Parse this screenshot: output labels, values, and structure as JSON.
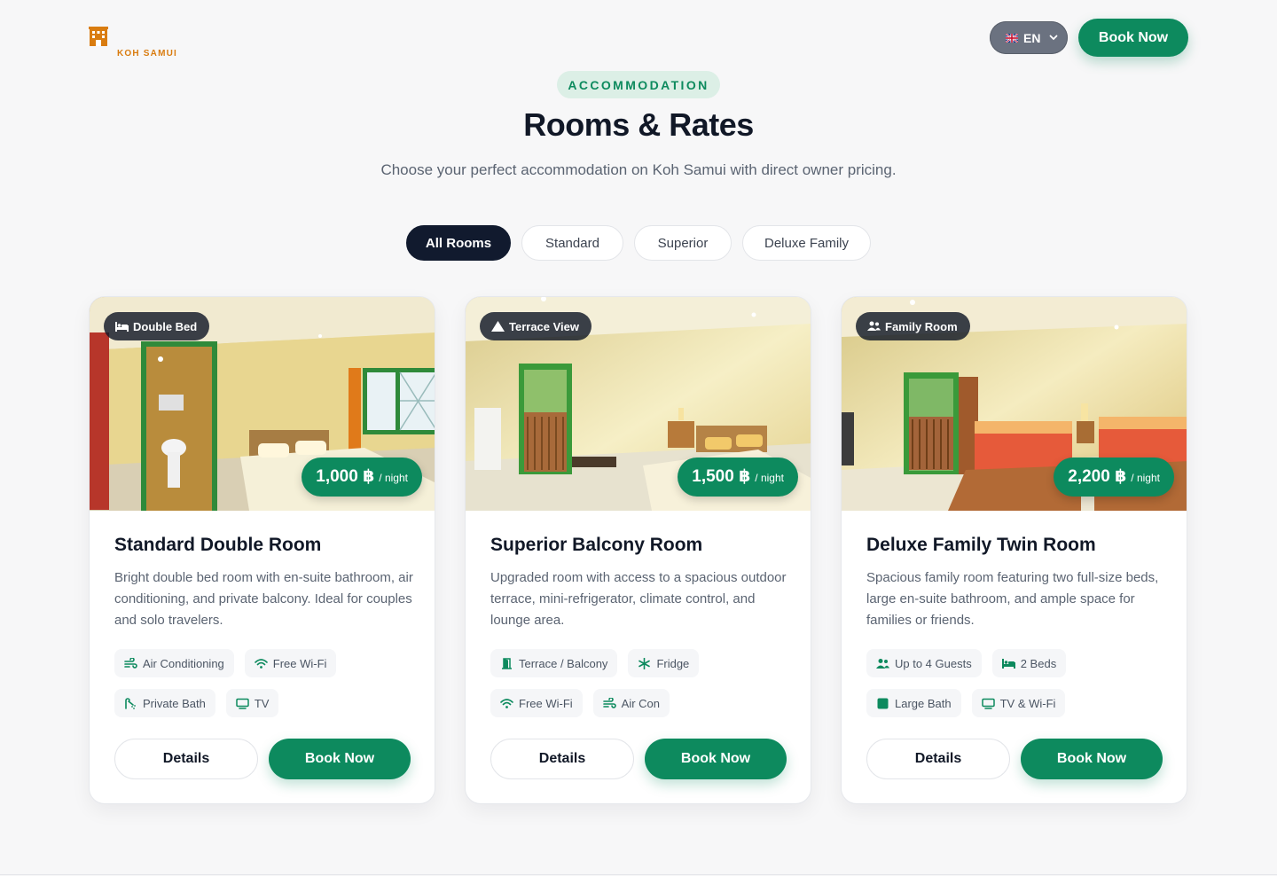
{
  "header": {
    "logo_name": "",
    "logo_sub": "KOH SAMUI",
    "language": "EN",
    "book_now": "Book Now"
  },
  "hero": {
    "eyebrow": "ACCOMMODATION",
    "title": "Rooms & Rates",
    "subtitle": "Choose your perfect accommodation on Koh Samui with direct owner pricing."
  },
  "filters": {
    "tabs": [
      "All Rooms",
      "Standard",
      "Superior",
      "Deluxe Family"
    ],
    "active": "All Rooms"
  },
  "colors": {
    "brand_green": "#0d8a5e",
    "dark_navy": "#111a2e",
    "accent_orange": "#d97c10"
  },
  "rooms": [
    {
      "badge": "Double Bed",
      "badge_icon": "bed-icon",
      "price": "1,000 ฿",
      "price_unit": "/ night",
      "title": "Standard Double Room",
      "description": "Bright double bed room with en-suite bathroom, air conditioning, and private balcony. Ideal for couples and solo travelers.",
      "amenities": [
        {
          "label": "Air Conditioning",
          "icon": "wind-icon"
        },
        {
          "label": "Free Wi-Fi",
          "icon": "wifi-icon"
        },
        {
          "label": "Private Bath",
          "icon": "shower-icon"
        },
        {
          "label": "TV",
          "icon": "tv-icon"
        }
      ],
      "details": "Details",
      "book": "Book Now"
    },
    {
      "badge": "Terrace View",
      "badge_icon": "mountain-icon",
      "price": "1,500 ฿",
      "price_unit": "/ night",
      "title": "Superior Balcony Room",
      "description": "Upgraded room with access to a spacious outdoor terrace, mini-refrigerator, climate control, and lounge area.",
      "amenities": [
        {
          "label": "Terrace / Balcony",
          "icon": "door-open-icon"
        },
        {
          "label": "Fridge",
          "icon": "snowflake-icon"
        },
        {
          "label": "Free Wi-Fi",
          "icon": "wifi-icon"
        },
        {
          "label": "Air Con",
          "icon": "wind-icon"
        }
      ],
      "details": "Details",
      "book": "Book Now"
    },
    {
      "badge": "Family Room",
      "badge_icon": "users-icon",
      "price": "2,200 ฿",
      "price_unit": "/ night",
      "title": "Deluxe Family Twin Room",
      "description": "Spacious family room featuring two full-size beds, large en-suite bathroom, and ample space for families or friends.",
      "amenities": [
        {
          "label": "Up to 4 Guests",
          "icon": "users-icon"
        },
        {
          "label": "2 Beds",
          "icon": "bed-icon"
        },
        {
          "label": "Large Bath",
          "icon": "bath-icon"
        },
        {
          "label": "TV & Wi-Fi",
          "icon": "tv-icon"
        }
      ],
      "details": "Details",
      "book": "Book Now"
    }
  ]
}
